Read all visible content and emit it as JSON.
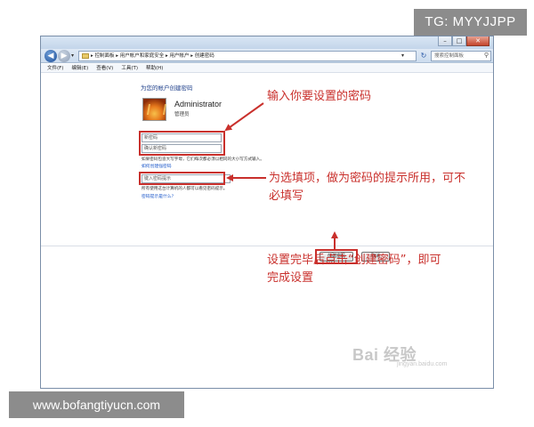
{
  "overlay": {
    "tg_badge": "TG: MYYJJPP",
    "site_badge": "www.bofangtiyucn.com"
  },
  "window": {
    "controls": {
      "minimize": "–",
      "maximize": "□",
      "close": "✕"
    },
    "address_path": "▸ 控制面板 ▸ 用户帐户和家庭安全 ▸ 用户帐户 ▸ 创建密码",
    "search_placeholder": "搜索控制面板",
    "menu": [
      "文件(F)",
      "编辑(E)",
      "查看(V)",
      "工具(T)",
      "帮助(H)"
    ]
  },
  "page": {
    "title": "为您的帐户创建密码",
    "user": {
      "name": "Administrator",
      "role": "管理员"
    },
    "new_password_placeholder": "新密码",
    "confirm_password_placeholder": "确认新密码",
    "case_note": "如果密码包含大写字母，它们每次都必须以相同的大小写方式输入。",
    "strong_password_link": "如何创建强密码",
    "hint_placeholder": "键入密码提示",
    "hint_note": "所有使用这台计算机的人都可以看见密码提示。",
    "hint_help_link": "密码提示是什么？",
    "create_button": "创建密码",
    "cancel_button": "取消",
    "watermark": "Bai 经验",
    "watermark_sub": "jingyan.baidu.com"
  },
  "annotations": {
    "enter_password": "输入你要设置的密码",
    "hint_line1": "为选填项，做为密码的提示所用，可不",
    "hint_line2": "必填写",
    "finish_line1": "设置完毕后点击“创建密码”，即可",
    "finish_line2": "完成设置"
  },
  "colors": {
    "annotation_red": "#c9302c",
    "link_blue": "#1a56c9",
    "title_blue": "#1e3f8a",
    "badge_gray": "#8c8c8c"
  }
}
